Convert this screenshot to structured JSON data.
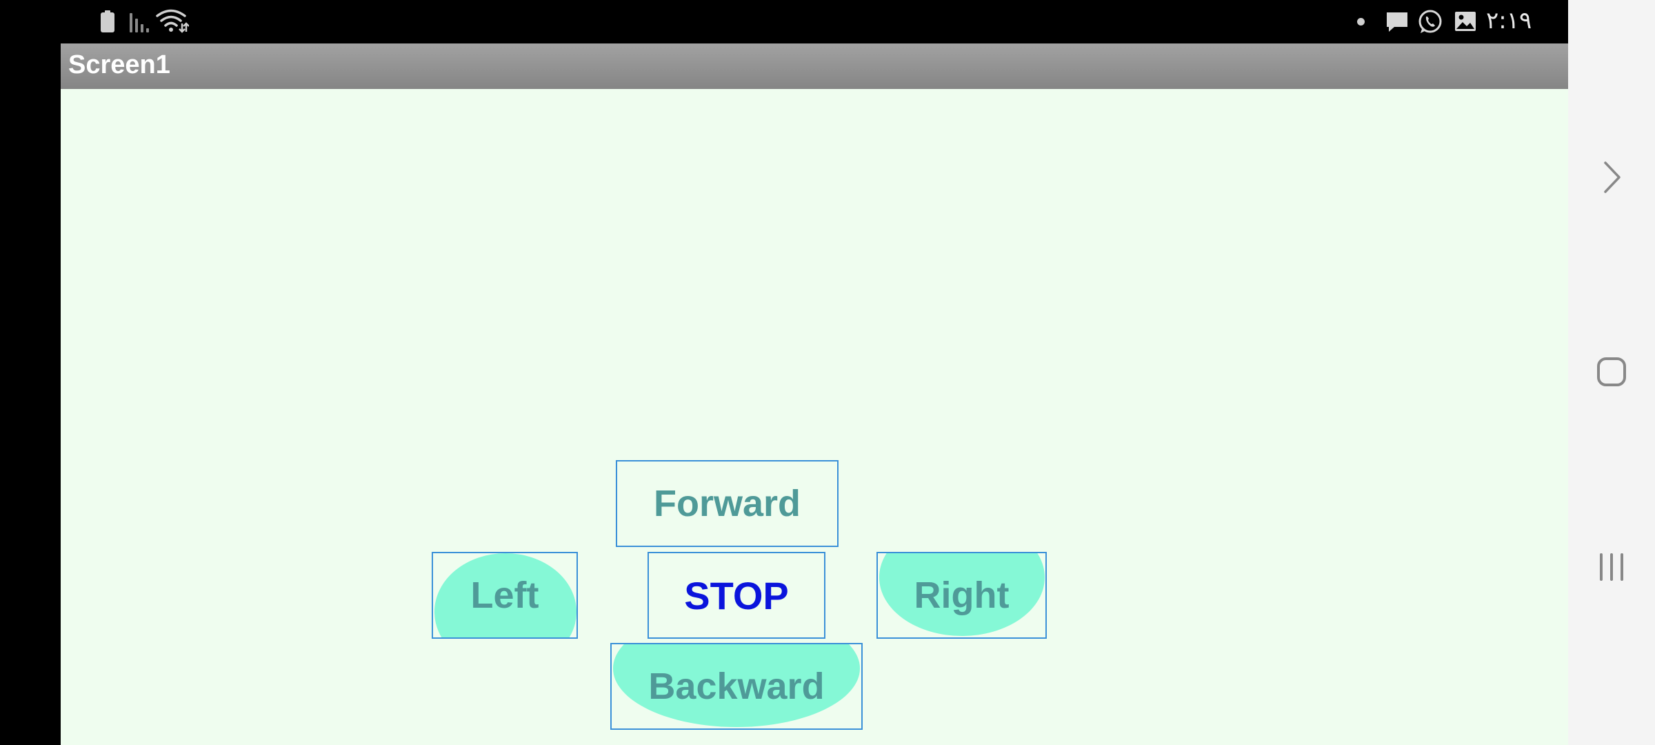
{
  "status_bar": {
    "icons_left": [
      "battery-icon",
      "signal-icon",
      "wifi-icon"
    ],
    "icons_right": [
      "notification-dot-icon",
      "message-icon",
      "whatsapp-icon",
      "gallery-icon"
    ],
    "time": "۲:۱۹"
  },
  "app": {
    "title": "Screen1",
    "background": "#effdef",
    "buttons": {
      "forward": "Forward",
      "left": "Left",
      "stop": "STOP",
      "right": "Right",
      "backward": "Backward"
    },
    "colors": {
      "button_text": "#4f9a98",
      "stop_text": "#0a14dc",
      "button_fill": "#85f8d6",
      "button_border": "#3a90d8"
    }
  },
  "nav_bar": {
    "icons": [
      "chevron-right-icon",
      "home-icon",
      "recents-icon"
    ]
  }
}
